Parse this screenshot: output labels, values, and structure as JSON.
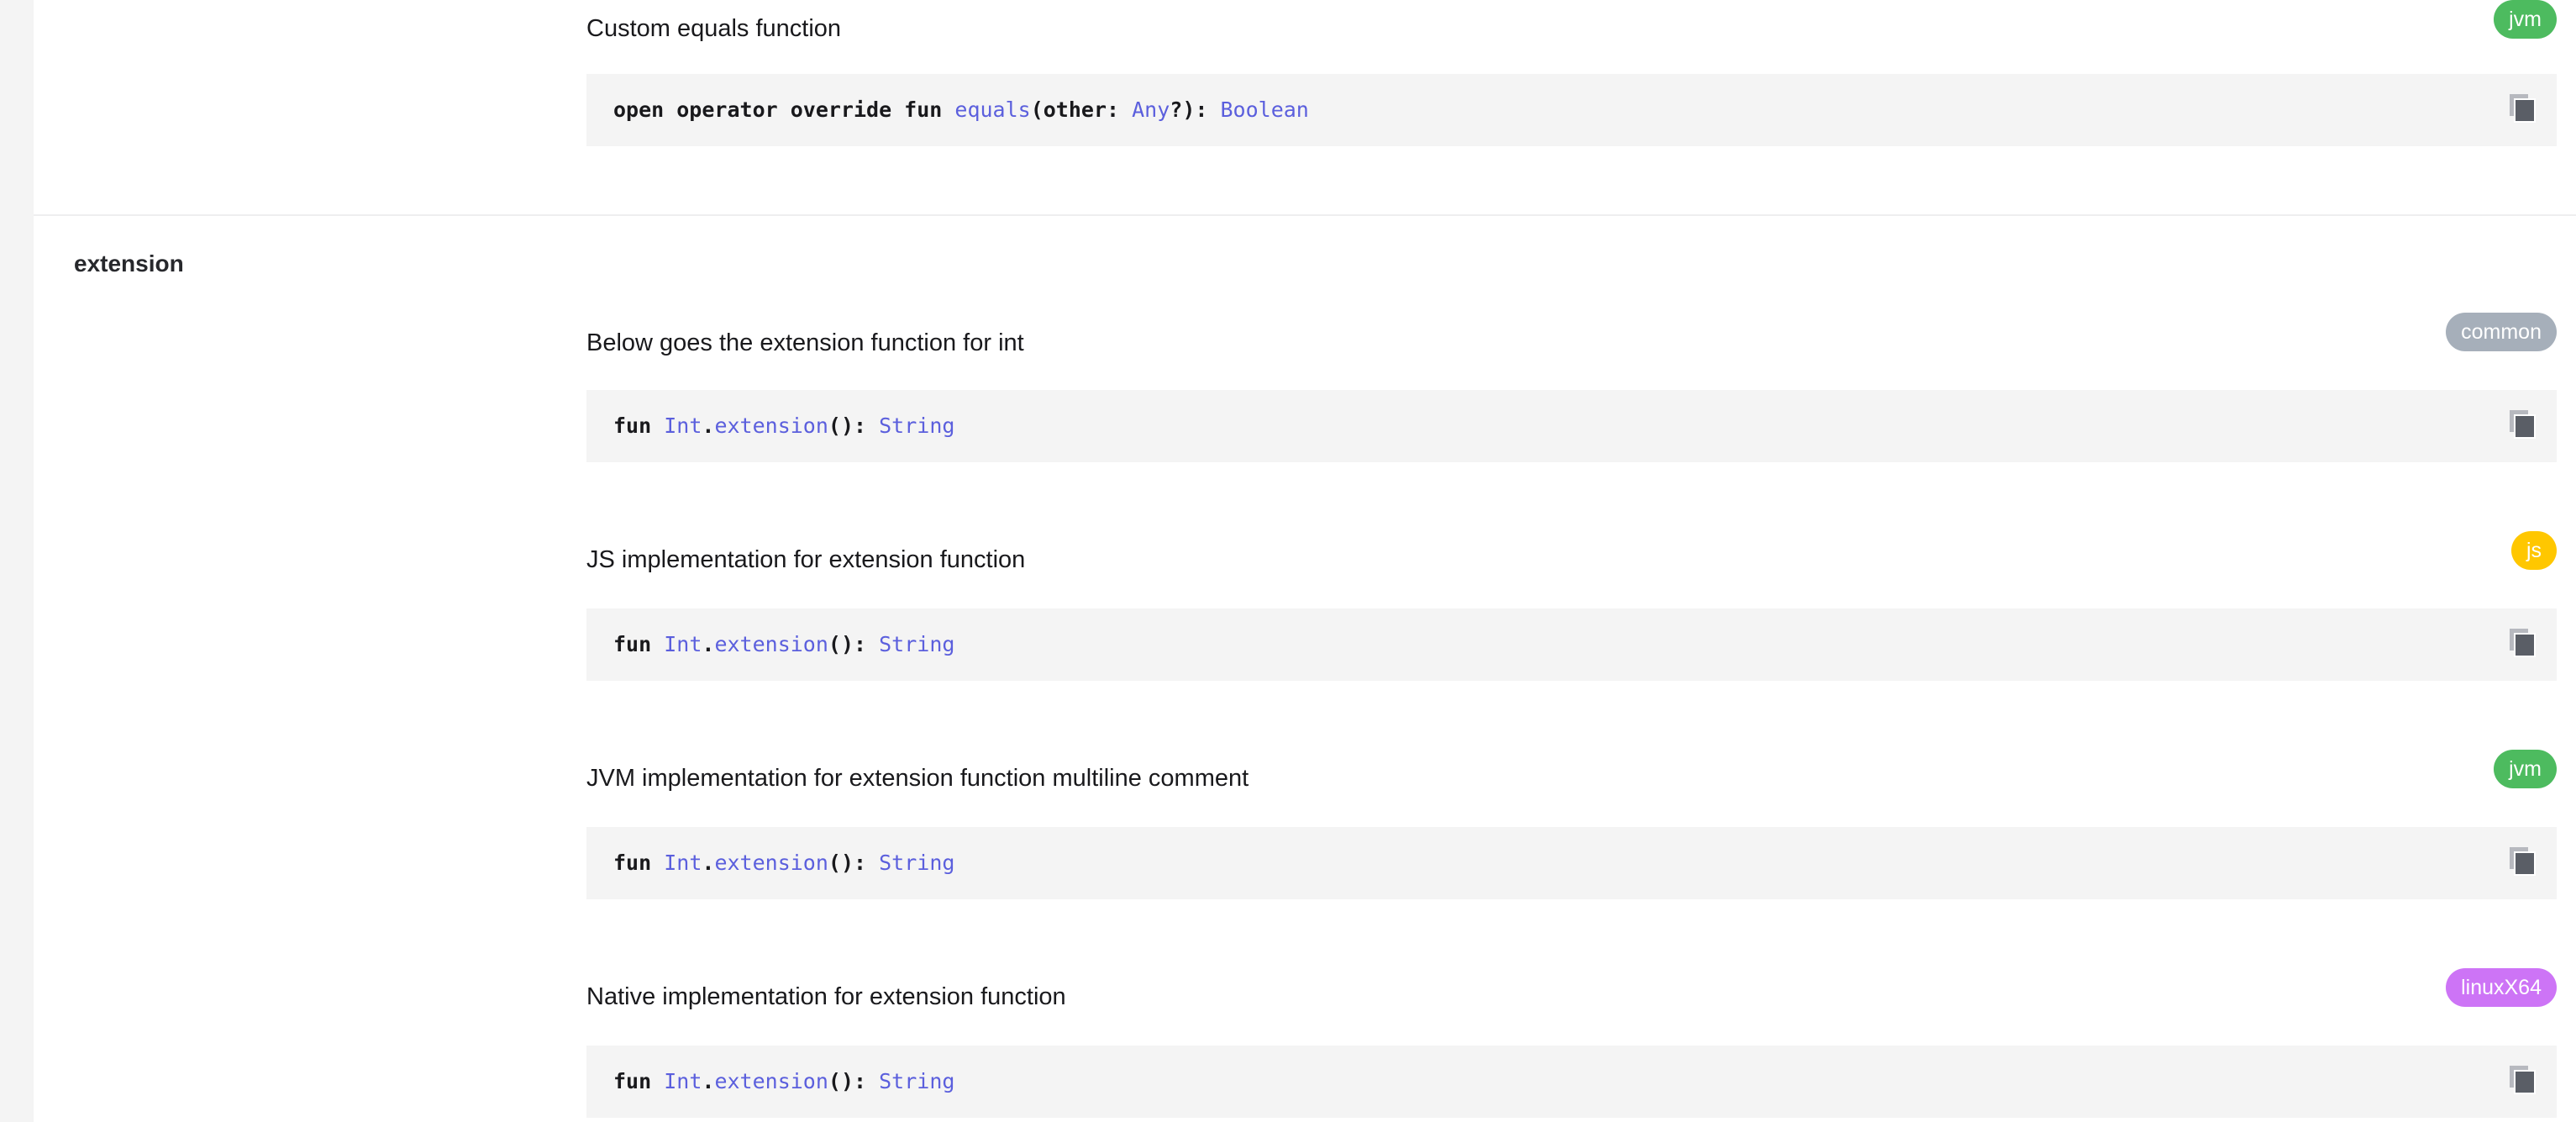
{
  "section": {
    "title": "extension"
  },
  "top_entry": {
    "description": "Custom equals function",
    "platform": "jvm",
    "code": {
      "kw1": "open operator override fun ",
      "fn": "equals",
      "p1": "(other: ",
      "t1": "Any",
      "p2": "?): ",
      "ret": "Boolean"
    }
  },
  "entries": [
    {
      "description": "Below goes the extension function for int",
      "platform": "common",
      "code": {
        "kw": "fun ",
        "recv": "Int",
        "dot": ".",
        "fn": "extension",
        "paren": "(): ",
        "ret": "String"
      }
    },
    {
      "description": "JS implementation for extension function",
      "platform": "js",
      "code": {
        "kw": "fun ",
        "recv": "Int",
        "dot": ".",
        "fn": "extension",
        "paren": "(): ",
        "ret": "String"
      }
    },
    {
      "description": "JVM implementation for extension function multiline comment",
      "platform": "jvm",
      "code": {
        "kw": "fun ",
        "recv": "Int",
        "dot": ".",
        "fn": "extension",
        "paren": "(): ",
        "ret": "String"
      }
    },
    {
      "description": "Native implementation for extension function",
      "platform": "linuxX64",
      "code": {
        "kw": "fun ",
        "recv": "Int",
        "dot": ".",
        "fn": "extension",
        "paren": "(): ",
        "ret": "String"
      }
    }
  ],
  "colors": {
    "jvm": "#4dbb5f",
    "common": "#a6afba",
    "js": "#ffc700",
    "linuxX64": "#cd74f6",
    "type_link": "#5b5fdd",
    "code_bg": "#f4f4f4"
  },
  "icons": {
    "copy": "copy-icon"
  }
}
